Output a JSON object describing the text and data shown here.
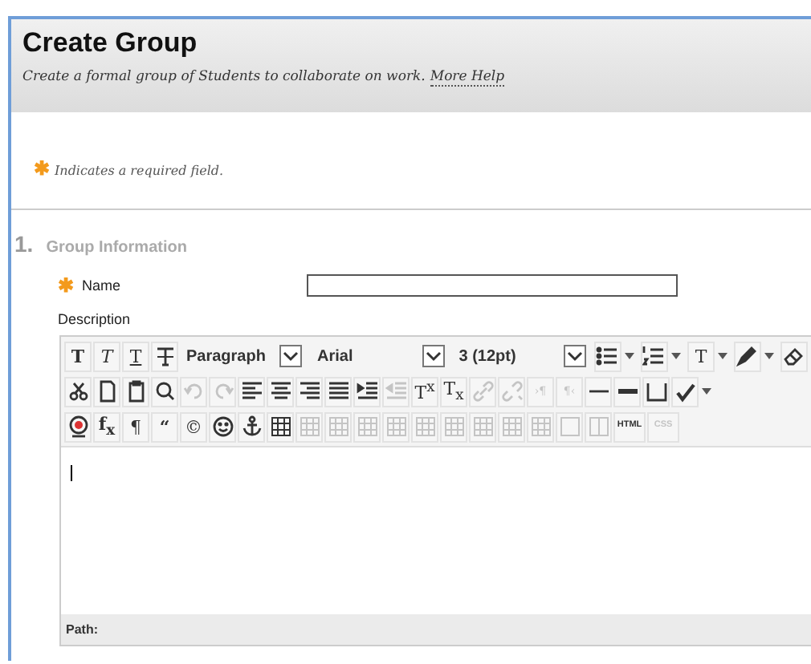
{
  "header": {
    "title": "Create Group",
    "subtitle": "Create a formal group of Students to collaborate on work.",
    "help_link": "More Help"
  },
  "required_note": {
    "mark": "✱",
    "text": "Indicates a required field."
  },
  "section": {
    "number": "1.",
    "title": "Group Information"
  },
  "name_field": {
    "mark": "✱",
    "label": "Name"
  },
  "description": {
    "label": "Description"
  },
  "toolbar": {
    "rows": [
      [
        {
          "kind": "bold",
          "label": "T",
          "disabled": false
        },
        {
          "kind": "italic",
          "label": "T",
          "disabled": false
        },
        {
          "kind": "underline",
          "label": "T",
          "disabled": false
        },
        {
          "kind": "strike",
          "disabled": false
        },
        {
          "kind": "select",
          "label": "Paragraph",
          "disabled": false
        },
        {
          "kind": "select",
          "label": "Arial",
          "disabled": false
        },
        {
          "kind": "select",
          "label": "3 (12pt)",
          "disabled": false
        },
        {
          "kind": "bullets",
          "dropdown": true,
          "disabled": false
        },
        {
          "kind": "numbers",
          "dropdown": true,
          "disabled": false
        },
        {
          "kind": "letter",
          "label": "T",
          "dropdown": true,
          "disabled": false
        },
        {
          "kind": "pen",
          "dropdown": true,
          "disabled": false
        },
        {
          "kind": "eraser",
          "disabled": false
        }
      ],
      [
        {
          "kind": "cut",
          "disabled": false
        },
        {
          "kind": "page",
          "disabled": false
        },
        {
          "kind": "paste",
          "disabled": false
        },
        {
          "kind": "search",
          "disabled": false
        },
        {
          "kind": "undo",
          "disabled": true
        },
        {
          "kind": "redo",
          "disabled": true
        },
        {
          "kind": "align-left",
          "disabled": false
        },
        {
          "kind": "align-center",
          "disabled": false
        },
        {
          "kind": "align-right",
          "disabled": false
        },
        {
          "kind": "justify",
          "disabled": false
        },
        {
          "kind": "indent",
          "disabled": false
        },
        {
          "kind": "outdent",
          "disabled": true
        },
        {
          "kind": "letter",
          "label": "T$^{x}$",
          "disabled": false
        },
        {
          "kind": "letter",
          "label": "T$_{x}$",
          "disabled": false
        },
        {
          "kind": "link",
          "disabled": true
        },
        {
          "kind": "unlink",
          "disabled": true
        },
        {
          "kind": "small",
          "label": "›¶",
          "disabled": true
        },
        {
          "kind": "small",
          "label": "¶‹",
          "disabled": true
        },
        {
          "kind": "rule",
          "disabled": false
        },
        {
          "kind": "thick-rule",
          "disabled": false
        },
        {
          "kind": "space",
          "disabled": false
        },
        {
          "kind": "spellcheck",
          "dropdown": true,
          "disabled": false
        }
      ],
      [
        {
          "kind": "record",
          "disabled": false
        },
        {
          "kind": "bold",
          "label": "f$_{x}$",
          "disabled": false
        },
        {
          "kind": "letter",
          "label": "¶",
          "disabled": false
        },
        {
          "kind": "bold",
          "label": "“",
          "disabled": false
        },
        {
          "kind": "letter",
          "label": "©",
          "disabled": false
        },
        {
          "kind": "smiley",
          "disabled": false
        },
        {
          "kind": "anchor",
          "disabled": false
        },
        {
          "kind": "table",
          "disabled": false
        },
        {
          "kind": "table",
          "disabled": true
        },
        {
          "kind": "table",
          "disabled": true
        },
        {
          "kind": "table",
          "disabled": true
        },
        {
          "kind": "table",
          "disabled": true
        },
        {
          "kind": "table",
          "disabled": true
        },
        {
          "kind": "table",
          "disabled": true
        },
        {
          "kind": "table",
          "disabled": true
        },
        {
          "kind": "table",
          "disabled": true
        },
        {
          "kind": "table",
          "disabled": true
        },
        {
          "kind": "box",
          "disabled": true
        },
        {
          "kind": "split",
          "disabled": true
        },
        {
          "kind": "tiny",
          "label": "HTML",
          "disabled": false
        },
        {
          "kind": "tiny",
          "label": "CSS",
          "disabled": true
        }
      ]
    ]
  },
  "path_bar": {
    "label": "Path:"
  }
}
